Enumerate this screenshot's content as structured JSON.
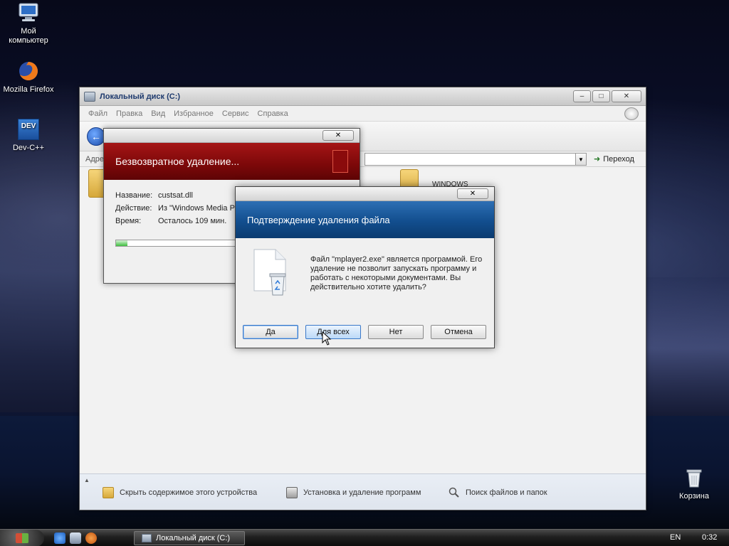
{
  "desktop": {
    "icons": [
      {
        "label_line1": "Мой",
        "label_line2": "компьютер",
        "icon": "computer-icon"
      },
      {
        "label_line1": "Mozilla Firefox",
        "label_line2": "",
        "icon": "firefox-icon"
      },
      {
        "label_line1": "Dev-C++",
        "label_line2": "",
        "icon": "devcpp-icon"
      },
      {
        "label_line1": "Корзина",
        "label_line2": "",
        "icon": "recycle-bin-icon"
      }
    ],
    "devcpp_badge": "DEV"
  },
  "explorer": {
    "title": "Локальный диск (C:)",
    "menu": [
      "Файл",
      "Правка",
      "Вид",
      "Избранное",
      "Сервис",
      "Справка"
    ],
    "address_label": "Адре",
    "go_label": "Переход",
    "folder_label": "WINDOWS",
    "tasks": [
      {
        "label": "Скрыть содержимое этого устройства",
        "icon": "folder-icon"
      },
      {
        "label": "Установка и удаление программ",
        "icon": "programs-icon"
      },
      {
        "label": "Поиск файлов и папок",
        "icon": "search-icon"
      }
    ]
  },
  "progress_dialog": {
    "header": "Безвозвратное удаление...",
    "name_label": "Название:",
    "name_value": "custsat.dll",
    "action_label": "Действие:",
    "action_value": "Из \"Windows Media Pla",
    "time_label": "Время:",
    "time_value": "Осталось 109 мин.",
    "progress_fraction": 0.08
  },
  "confirm_dialog": {
    "header": "Подтверждение удаления файла",
    "message": "Файл \"mplayer2.exe\" является программой. Его удаление не позволит запускать программу и работать с некоторыми документами. Вы действительно хотите удалить?",
    "buttons": {
      "yes": "Да",
      "yes_all": "Для всех",
      "no": "Нет",
      "cancel": "Отмена"
    }
  },
  "taskbar": {
    "task_label": "Локальный диск (C:)",
    "language": "EN",
    "time": "0:32"
  },
  "colors": {
    "progress_header": "#8b0c0d",
    "confirm_header": "#1a5aa0",
    "progress_fill": "#3fbf3f"
  }
}
